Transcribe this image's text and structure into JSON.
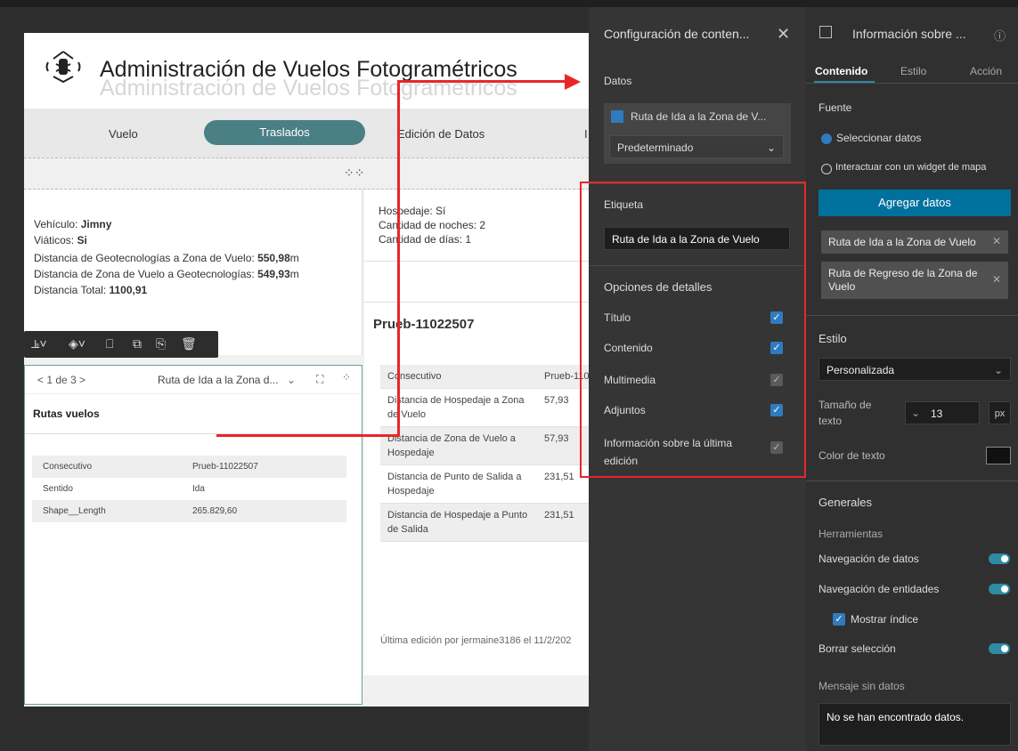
{
  "app": {
    "title": "Administración de Vuelos Fotogramétricos",
    "nav": [
      "Vuelo",
      "Traslados",
      "Edición de Datos",
      "I"
    ],
    "active_nav": "Traslados"
  },
  "card_left": {
    "lines": [
      {
        "label": "Vehículo: ",
        "value": "Jimny",
        "unit": ""
      },
      {
        "label": "Viáticos: ",
        "value": "Si",
        "unit": ""
      },
      {
        "label": "Distancia de Geotecnologías a Zona de Vuelo: ",
        "value": "550,98",
        "unit": "m"
      },
      {
        "label": "Distancia de Zona de Vuelo a Geotecnologías: ",
        "value": "549,93",
        "unit": "m"
      },
      {
        "label": "Distancia Total: ",
        "value": "1100,91",
        "unit": ""
      }
    ]
  },
  "card_right": {
    "lines": [
      "Hospedaje: Sí",
      "Cantidad de noches: 2",
      "Cantidad de días: 1"
    ]
  },
  "widget": {
    "pager": "< 1 de 3 >",
    "layer_select": "Ruta de Ida a la Zona d...",
    "title": "Rutas vuelos",
    "rows": [
      {
        "k": "Consecutivo",
        "v": "Prueb-11022507"
      },
      {
        "k": "Sentido",
        "v": "Ida"
      },
      {
        "k": "Shape__Length",
        "v": "265.829,60"
      }
    ]
  },
  "detail": {
    "title": "Prueb-11022507",
    "rows": [
      {
        "k": "Consecutivo",
        "v": "Prueb-110"
      },
      {
        "k": "Distancia de Hospedaje a Zona de Vuelo",
        "v": "57,93"
      },
      {
        "k": "Distancia de Zona de Vuelo a Hospedaje",
        "v": "57,93"
      },
      {
        "k": "Distancia de Punto de Salida a Hospedaje",
        "v": "231,51"
      },
      {
        "k": "Distancia de Hospedaje a Punto de Salida",
        "v": "231,51"
      }
    ],
    "last_edit": "Última edición por jermaine3186 el 11/2/202"
  },
  "config_panel": {
    "title": "Configuración de conten...",
    "datos_label": "Datos",
    "datasource": "Ruta de Ida a la Zona de V...",
    "view": "Predeterminado",
    "etiqueta_label": "Etiqueta",
    "etiqueta_value": "Ruta de Ida a la Zona de Vuelo",
    "opciones_label": "Opciones de detalles",
    "options": [
      {
        "label": "Título",
        "checked": true,
        "disabled": false
      },
      {
        "label": "Contenido",
        "checked": true,
        "disabled": false
      },
      {
        "label": "Multimedia",
        "checked": true,
        "disabled": true
      },
      {
        "label": "Adjuntos",
        "checked": true,
        "disabled": false
      },
      {
        "label": "Información sobre la última edición",
        "checked": true,
        "disabled": true
      }
    ]
  },
  "info_panel": {
    "title": "Información sobre ...",
    "tabs": [
      "Contenido",
      "Estilo",
      "Acción"
    ],
    "fuente_label": "Fuente",
    "radio1": "Seleccionar datos",
    "radio2": "Interactuar con un widget de mapa",
    "agregar": "Agregar datos",
    "chip1": "Ruta de Ida a la Zona de Vuelo",
    "chip2": "Ruta de Regreso de la Zona de Vuelo",
    "estilo_label": "Estilo",
    "estilo_value": "Personalizada",
    "tamano_label": "Tamaño de texto",
    "tamano_value": "13",
    "tamano_unit": "px",
    "color_label": "Color de texto",
    "generales_label": "Generales",
    "herramientas_label": "Herramientas",
    "nav_datos": "Navegación de datos",
    "nav_entidades": "Navegación de entidades",
    "mostrar_indice": "Mostrar índice",
    "borrar_sel": "Borrar selección",
    "msg_label": "Mensaje sin datos",
    "msg_value": "No se han encontrado datos."
  }
}
